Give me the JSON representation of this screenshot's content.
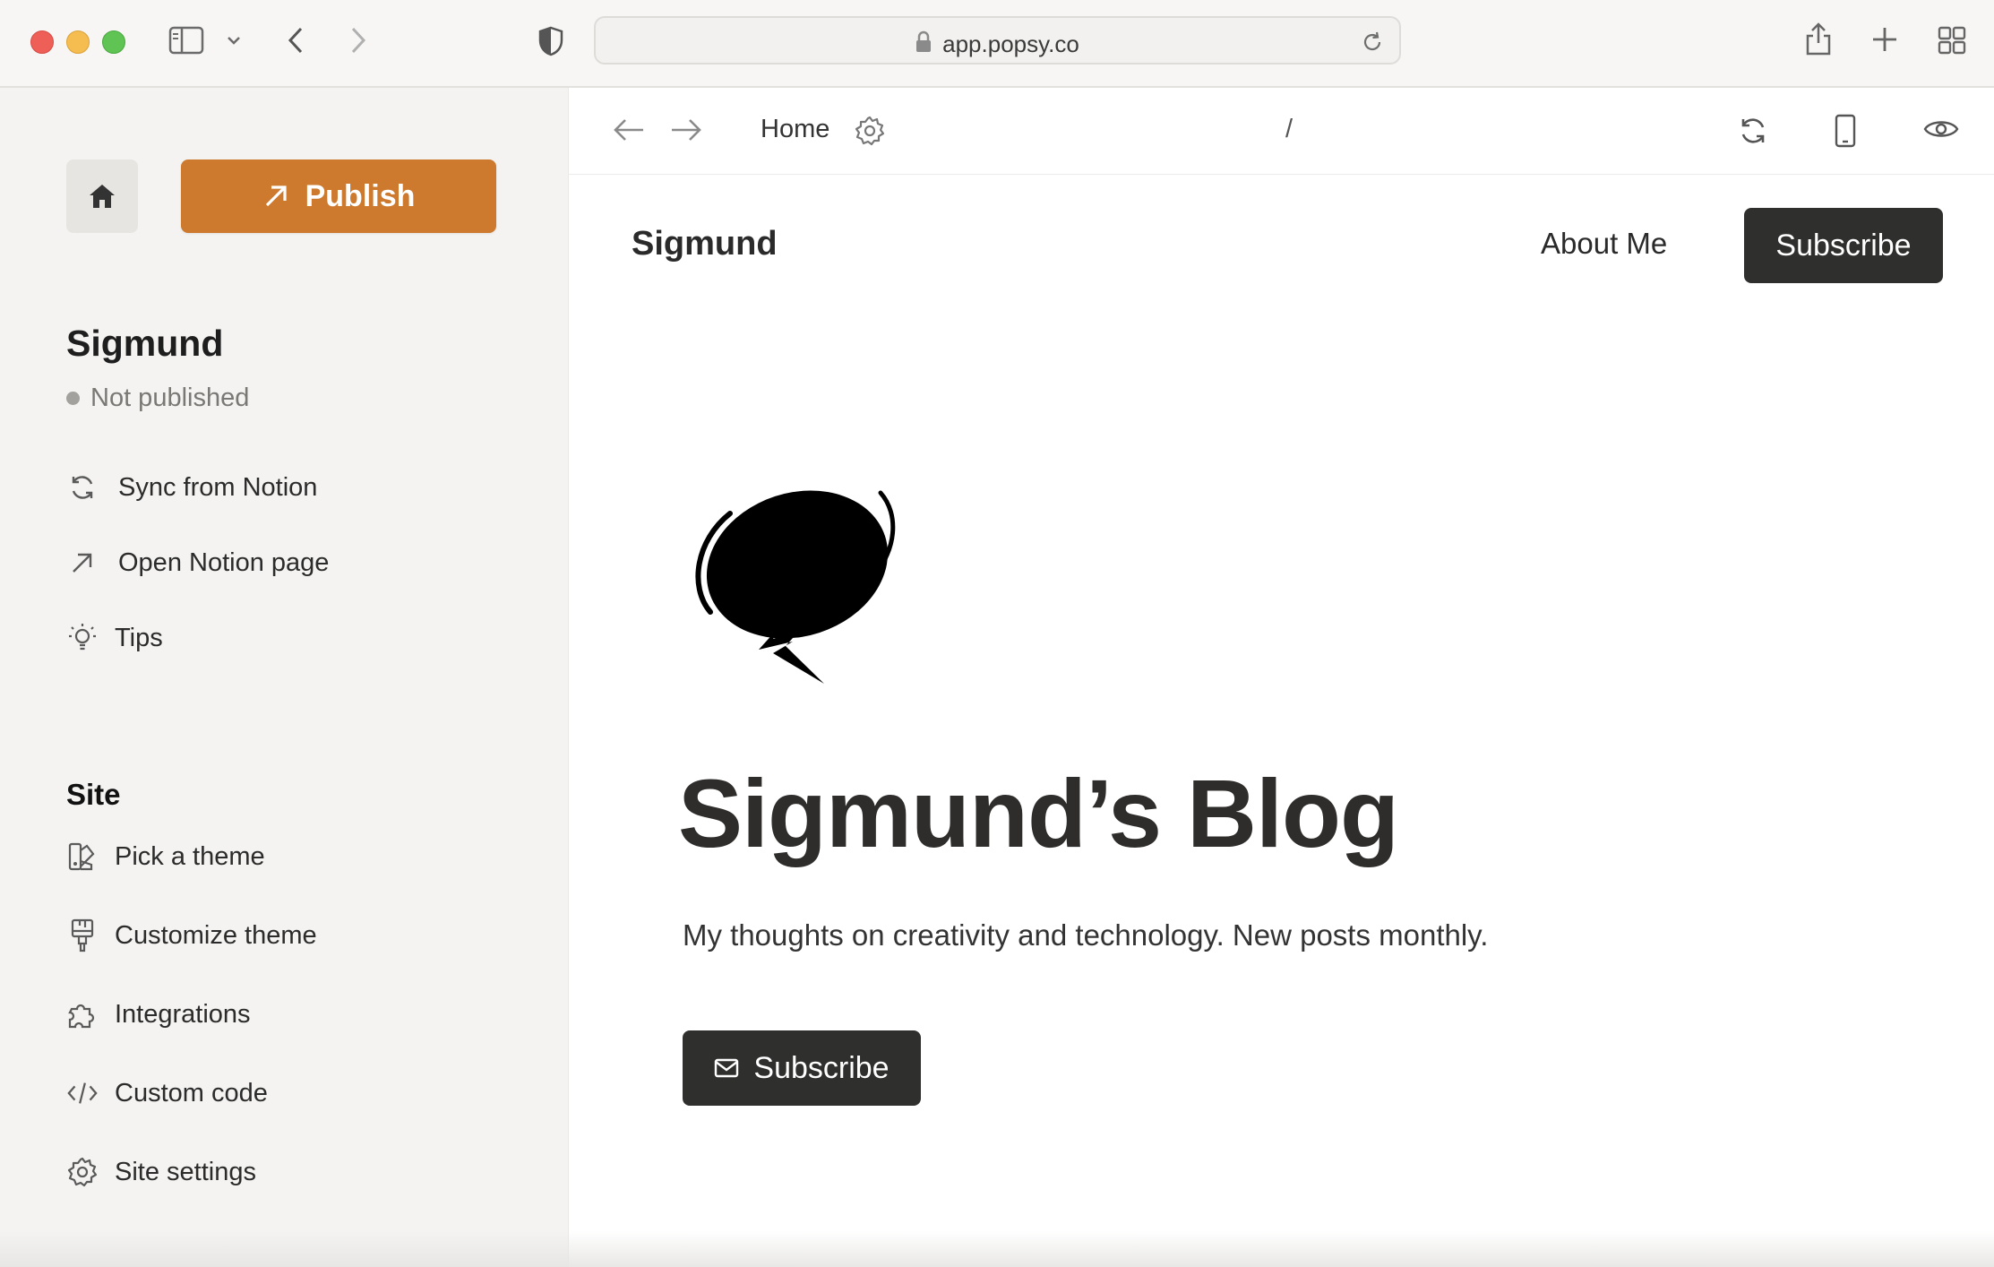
{
  "browser": {
    "url": "app.popsy.co",
    "icons": [
      "close-window",
      "minimize-window",
      "zoom-window",
      "sidebar-toggle-icon",
      "chevron-down-icon",
      "back-icon",
      "forward-icon",
      "privacy-shield-icon",
      "lock-icon",
      "reload-icon",
      "share-icon",
      "new-tab-icon",
      "tab-overview-icon"
    ]
  },
  "sidebar": {
    "publish_label": "Publish",
    "site_name": "Sigmund",
    "status": "Not published",
    "actions": [
      {
        "label": "Sync from Notion",
        "icon": "sync-icon"
      },
      {
        "label": "Open Notion page",
        "icon": "arrow-up-right-icon"
      },
      {
        "label": "Tips",
        "icon": "lightbulb-icon"
      }
    ],
    "section_title": "Site",
    "site_items": [
      {
        "label": "Pick a theme",
        "icon": "theme-icon"
      },
      {
        "label": "Customize theme",
        "icon": "paint-brush-icon"
      },
      {
        "label": "Integrations",
        "icon": "puzzle-icon"
      },
      {
        "label": "Custom code",
        "icon": "code-icon"
      },
      {
        "label": "Site settings",
        "icon": "gear-icon"
      }
    ]
  },
  "toolbar": {
    "page_name": "Home",
    "path": "/"
  },
  "preview": {
    "brand": "Sigmund",
    "nav_link": "About Me",
    "nav_button": "Subscribe",
    "title": "Sigmund’s Blog",
    "description": "My thoughts on creativity and technology. New posts monthly.",
    "cta": "Subscribe"
  },
  "colors": {
    "accent": "#cd7a2e",
    "sidebar_bg": "#f4f3f1",
    "dark_button": "#2f2f2d"
  }
}
